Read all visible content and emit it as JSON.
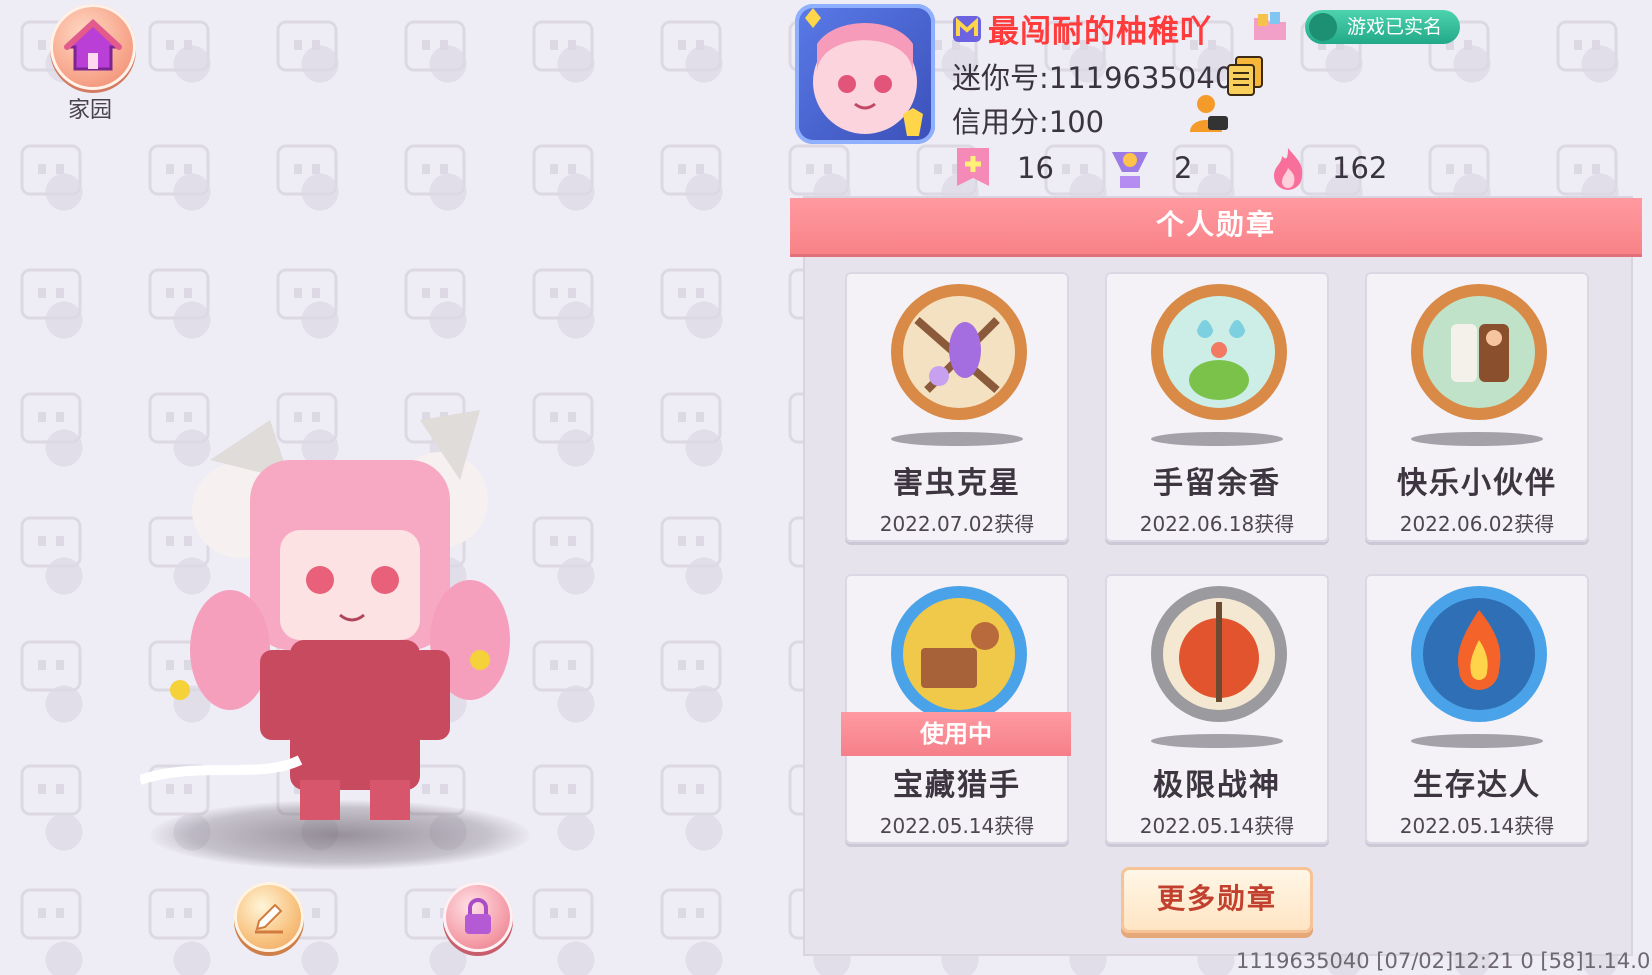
{
  "home": {
    "label": "家园",
    "icon": "house-icon"
  },
  "profile": {
    "name": "最闯耐的柚稚吖",
    "vip_icon": "vip-m-icon",
    "verified_label": "游戏已实名",
    "id_label": "迷你号:1119635040",
    "credit_label": "信用分:100",
    "stats": [
      {
        "icon": "medal-plus-icon",
        "value": "16"
      },
      {
        "icon": "trophy-icon",
        "value": "2"
      },
      {
        "icon": "flame-icon",
        "value": "162"
      }
    ]
  },
  "medals": {
    "header": "个人勋章",
    "items": [
      {
        "name": "害虫克星",
        "date": "2022.07.02获得",
        "style": "bronze",
        "in_use": false
      },
      {
        "name": "手留余香",
        "date": "2022.06.18获得",
        "style": "bronze",
        "in_use": false
      },
      {
        "name": "快乐小伙伴",
        "date": "2022.06.02获得",
        "style": "bronze",
        "in_use": false
      },
      {
        "name": "宝藏猎手",
        "date": "2022.05.14获得",
        "style": "blue",
        "in_use": true
      },
      {
        "name": "极限战神",
        "date": "2022.05.14获得",
        "style": "silver",
        "in_use": false
      },
      {
        "name": "生存达人",
        "date": "2022.05.14获得",
        "style": "blue",
        "in_use": false
      }
    ],
    "in_use_label": "使用中",
    "more_button": "更多勋章"
  },
  "footer": "1119635040   [07/02]12:21 0  [58]1.14.0",
  "colors": {
    "accent_red": "#ff3b3b",
    "header_pink": "#f88288",
    "button_text": "#c2402e"
  }
}
